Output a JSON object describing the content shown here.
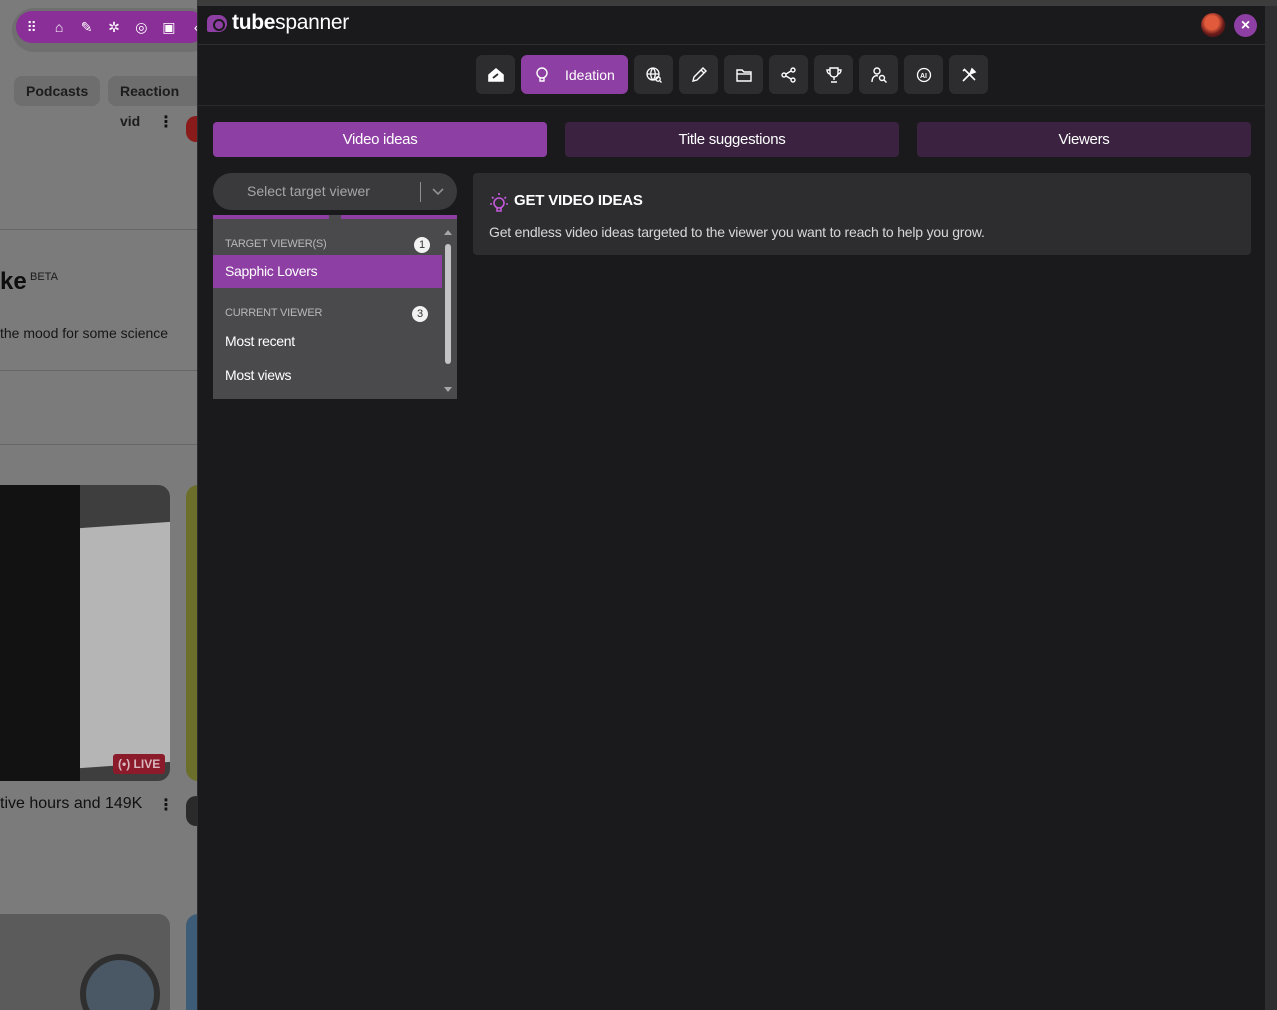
{
  "background_page": {
    "chips": [
      "Podcasts",
      "Reaction vid"
    ],
    "heading": "ke",
    "beta_badge": "BETA",
    "subtitle": "the mood for some science",
    "live_badge": "LIVE",
    "video_title": "tive hours and 149K"
  },
  "extension": {
    "brand_bold": "tube",
    "brand_regular": "spanner",
    "close_icon": "×",
    "nav": {
      "active_label": "Ideation",
      "icons": [
        "home-icon",
        "lightbulb-icon",
        "globe-search-icon",
        "pen-icon",
        "folder-icon",
        "share-icon",
        "trophy-icon",
        "user-search-icon",
        "ai-icon",
        "tools-icon"
      ]
    },
    "tabs": [
      "Video ideas",
      "Title suggestions",
      "Viewers"
    ],
    "select": {
      "placeholder": "Select target viewer"
    },
    "dropdown": {
      "group1_title": "TARGET VIEWER(S)",
      "group1_count": "1",
      "group1_items": [
        "Sapphic Lovers"
      ],
      "group2_title": "CURRENT VIEWER",
      "group2_count": "3",
      "group2_items": [
        "Most recent",
        "Most views"
      ]
    },
    "info": {
      "title": "GET VIDEO IDEAS",
      "description": "Get endless video ideas targeted to the viewer you want to reach to help you grow."
    },
    "colors": {
      "accent": "#8e3fa3",
      "panel_bg": "#1a1a1c",
      "card_bg": "#2d2d30"
    }
  }
}
